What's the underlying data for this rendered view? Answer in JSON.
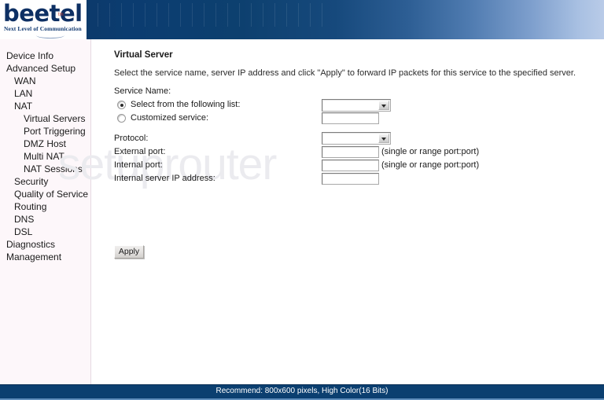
{
  "brand": {
    "name": "beetel",
    "trademark": "tm",
    "tagline": "Next Level of Communication"
  },
  "watermark": "setuprouter",
  "sidebar": {
    "items": [
      {
        "label": "Device Info",
        "level": 1
      },
      {
        "label": "Advanced Setup",
        "level": 1
      },
      {
        "label": "WAN",
        "level": 2
      },
      {
        "label": "LAN",
        "level": 2
      },
      {
        "label": "NAT",
        "level": 2
      },
      {
        "label": "Virtual Servers",
        "level": 3
      },
      {
        "label": "Port Triggering",
        "level": 3
      },
      {
        "label": "DMZ Host",
        "level": 3
      },
      {
        "label": "Multi NAT",
        "level": 3
      },
      {
        "label": "NAT Sessions",
        "level": 3
      },
      {
        "label": "Security",
        "level": 2
      },
      {
        "label": "Quality of Service",
        "level": 2
      },
      {
        "label": "Routing",
        "level": 2
      },
      {
        "label": "DNS",
        "level": 2
      },
      {
        "label": "DSL",
        "level": 2
      },
      {
        "label": "Diagnostics",
        "level": 1
      },
      {
        "label": "Management",
        "level": 1
      }
    ]
  },
  "main": {
    "title": "Virtual Server",
    "description": "Select the service name, server IP address and click \"Apply\" to forward IP packets for this service to the specified server.",
    "service_name_label": "Service Name:",
    "option_select_list_label": "Select from the following list:",
    "option_select_list_selected": true,
    "service_select_value": "",
    "option_custom_label": "Customized service:",
    "option_custom_selected": false,
    "custom_service_value": "",
    "protocol_label": "Protocol:",
    "protocol_value": "",
    "external_port_label": "External port:",
    "external_port_value": "",
    "external_port_hint": "(single or range port:port)",
    "internal_port_label": "Internal port:",
    "internal_port_value": "",
    "internal_port_hint": "(single or range port:port)",
    "internal_ip_label": "Internal server IP address:",
    "internal_ip_value": "",
    "apply_label": "Apply"
  },
  "footer": {
    "text": "Recommend: 800x600 pixels, High Color(16 Bits)"
  }
}
